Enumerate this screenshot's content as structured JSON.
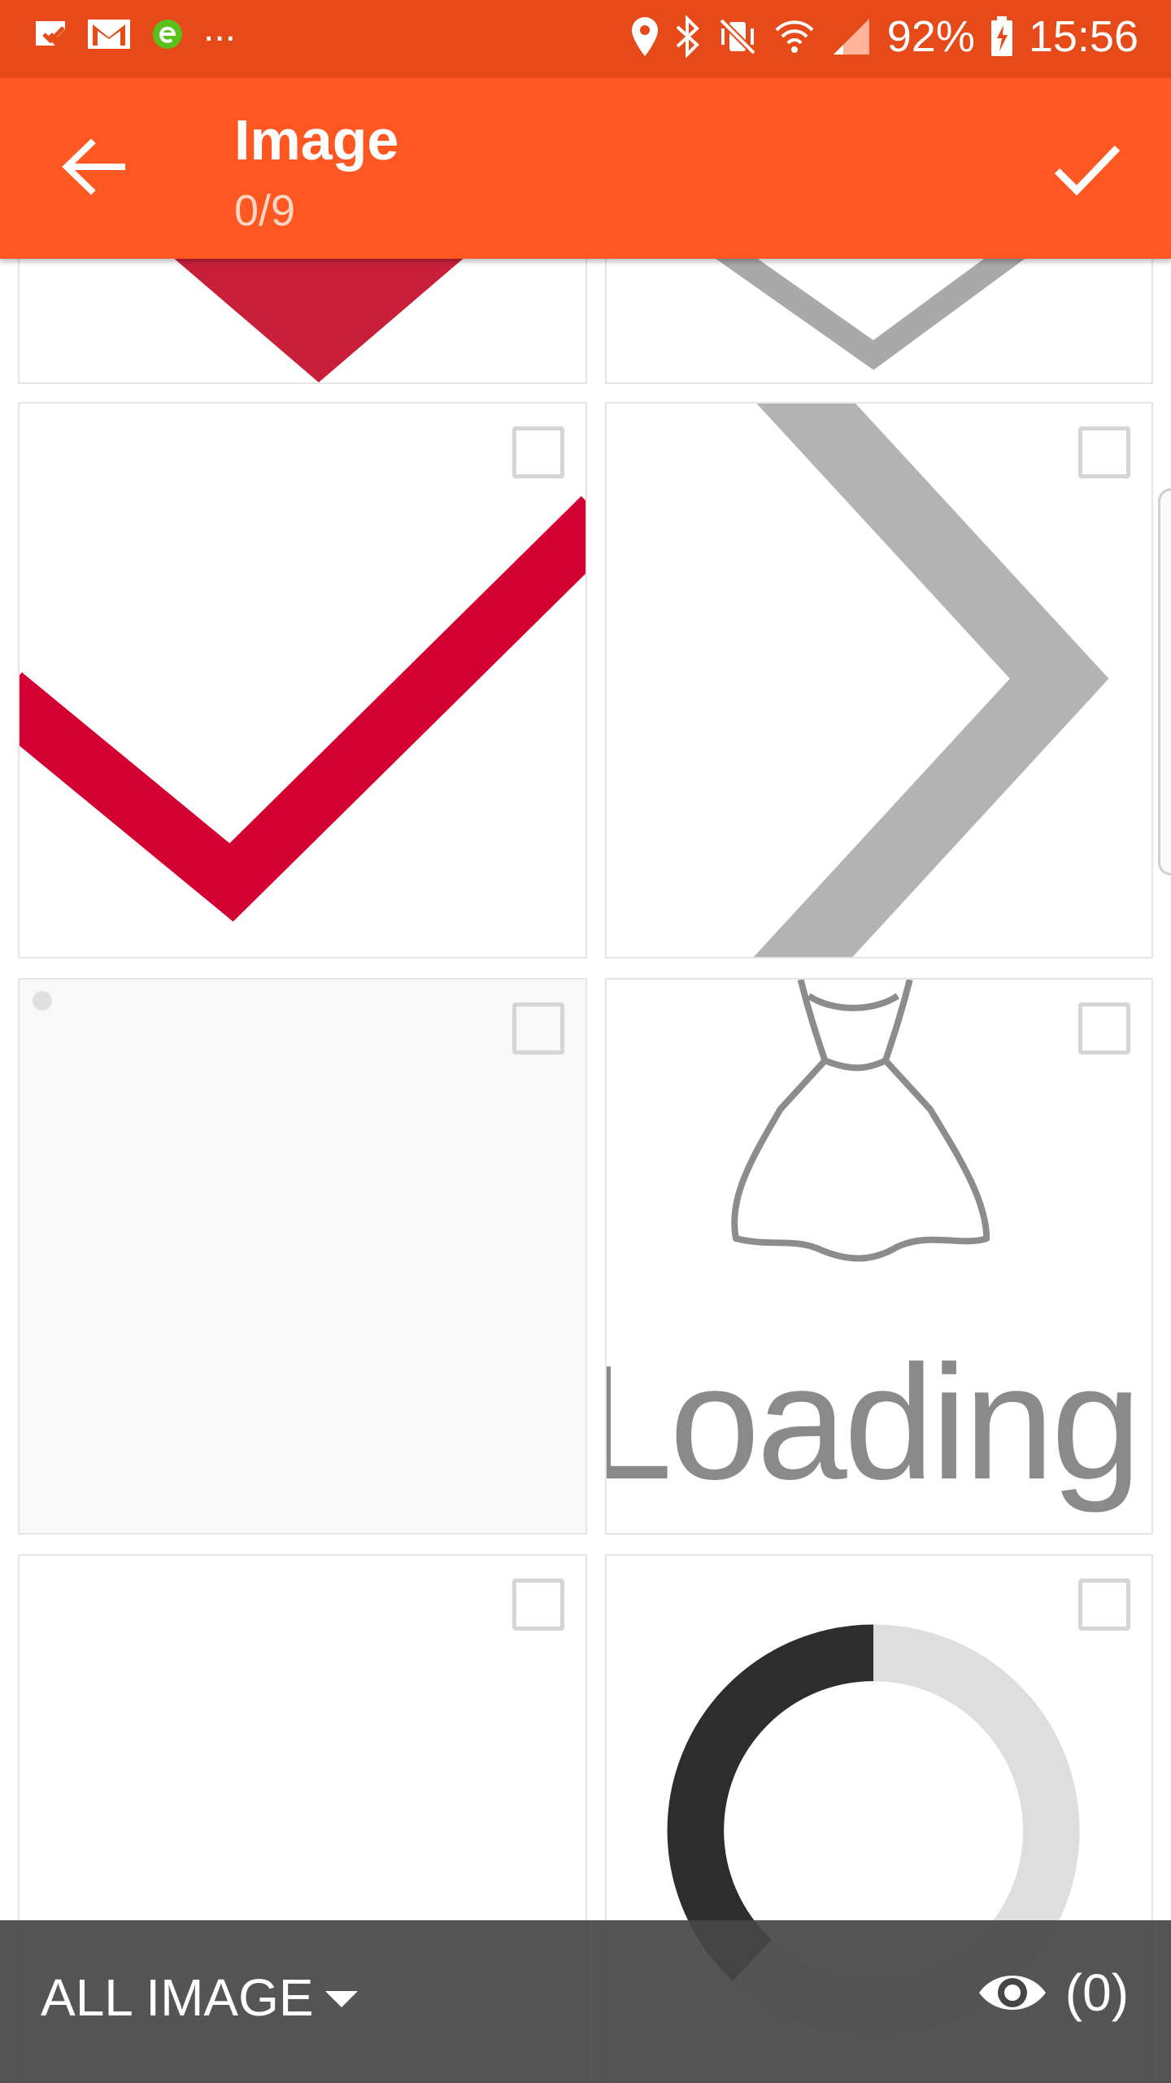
{
  "status_bar": {
    "battery": "92%",
    "time": "15:56",
    "overflow": "..."
  },
  "app_bar": {
    "title": "Image",
    "subtitle": "0/9"
  },
  "grid": {
    "loading_label": "Loading"
  },
  "bottom_bar": {
    "album_label": "ALL IMAGE",
    "preview_count": "(0)"
  },
  "colors": {
    "status_bar": "#e64a19",
    "app_bar": "#ff5722",
    "check_red": "#d50032",
    "bottom_bar": "#464646"
  }
}
